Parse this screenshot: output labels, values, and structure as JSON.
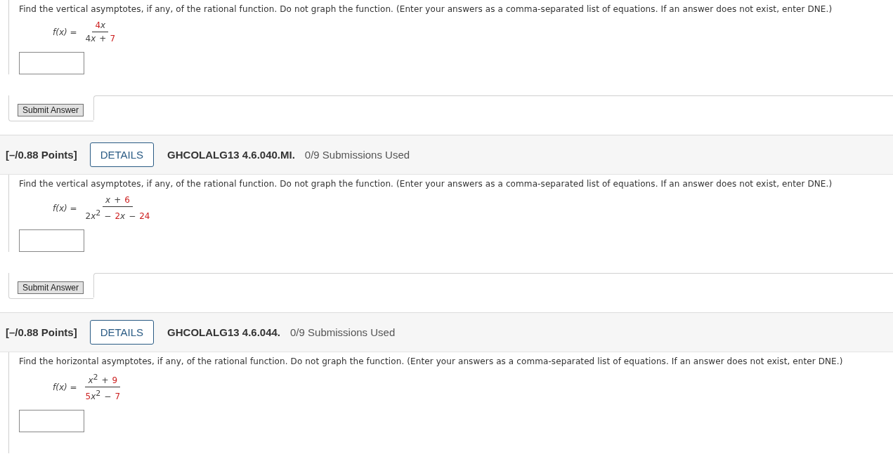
{
  "problems": [
    {
      "question": "Find the vertical asymptotes, if any, of the rational function. Do not graph the function. (Enter your answers as a comma-separated list of equations. If an answer does not exist, enter DNE.)",
      "formula": {
        "lhs": "f(x) =",
        "numerator": [
          {
            "kind": "num",
            "text": "4"
          },
          {
            "kind": "var",
            "text": "x"
          }
        ],
        "denominator": [
          {
            "kind": "plain",
            "text": "4"
          },
          {
            "kind": "var",
            "text": "x"
          },
          {
            "kind": "op",
            "text": "+"
          },
          {
            "kind": "num",
            "text": "7"
          }
        ]
      },
      "submit": "Submit Answer"
    },
    {
      "header": {
        "points": "[–/0.88 Points]",
        "details": "DETAILS",
        "code": "GHCOLALG13 4.6.040.MI.",
        "submissions": "0/9 Submissions Used"
      },
      "question": "Find the vertical asymptotes, if any, of the rational function. Do not graph the function. (Enter your answers as a comma-separated list of equations. If an answer does not exist, enter DNE.)",
      "formula": {
        "lhs": "f(x) =",
        "numerator": [
          {
            "kind": "var",
            "text": "x"
          },
          {
            "kind": "op",
            "text": "+"
          },
          {
            "kind": "num",
            "text": "6"
          }
        ],
        "denominator": [
          {
            "kind": "plain",
            "text": "2"
          },
          {
            "kind": "var",
            "text": "x"
          },
          {
            "kind": "sup",
            "text": "2"
          },
          {
            "kind": "op",
            "text": "−"
          },
          {
            "kind": "num",
            "text": "2"
          },
          {
            "kind": "var",
            "text": "x"
          },
          {
            "kind": "op",
            "text": "−"
          },
          {
            "kind": "num",
            "text": "24"
          }
        ]
      },
      "submit": "Submit Answer"
    },
    {
      "header": {
        "points": "[–/0.88 Points]",
        "details": "DETAILS",
        "code": "GHCOLALG13 4.6.044.",
        "submissions": "0/9 Submissions Used"
      },
      "question": "Find the horizontal asymptotes, if any, of the rational function. Do not graph the function. (Enter your answers as a comma-separated list of equations. If an answer does not exist, enter DNE.)",
      "formula": {
        "lhs": "f(x) =",
        "numerator": [
          {
            "kind": "var",
            "text": "x"
          },
          {
            "kind": "sup",
            "text": "2"
          },
          {
            "kind": "op",
            "text": "+"
          },
          {
            "kind": "num",
            "text": "9"
          }
        ],
        "denominator": [
          {
            "kind": "num",
            "text": "5"
          },
          {
            "kind": "var",
            "text": "x"
          },
          {
            "kind": "sup",
            "text": "2"
          },
          {
            "kind": "op",
            "text": "−"
          },
          {
            "kind": "num",
            "text": "7"
          }
        ]
      }
    }
  ]
}
